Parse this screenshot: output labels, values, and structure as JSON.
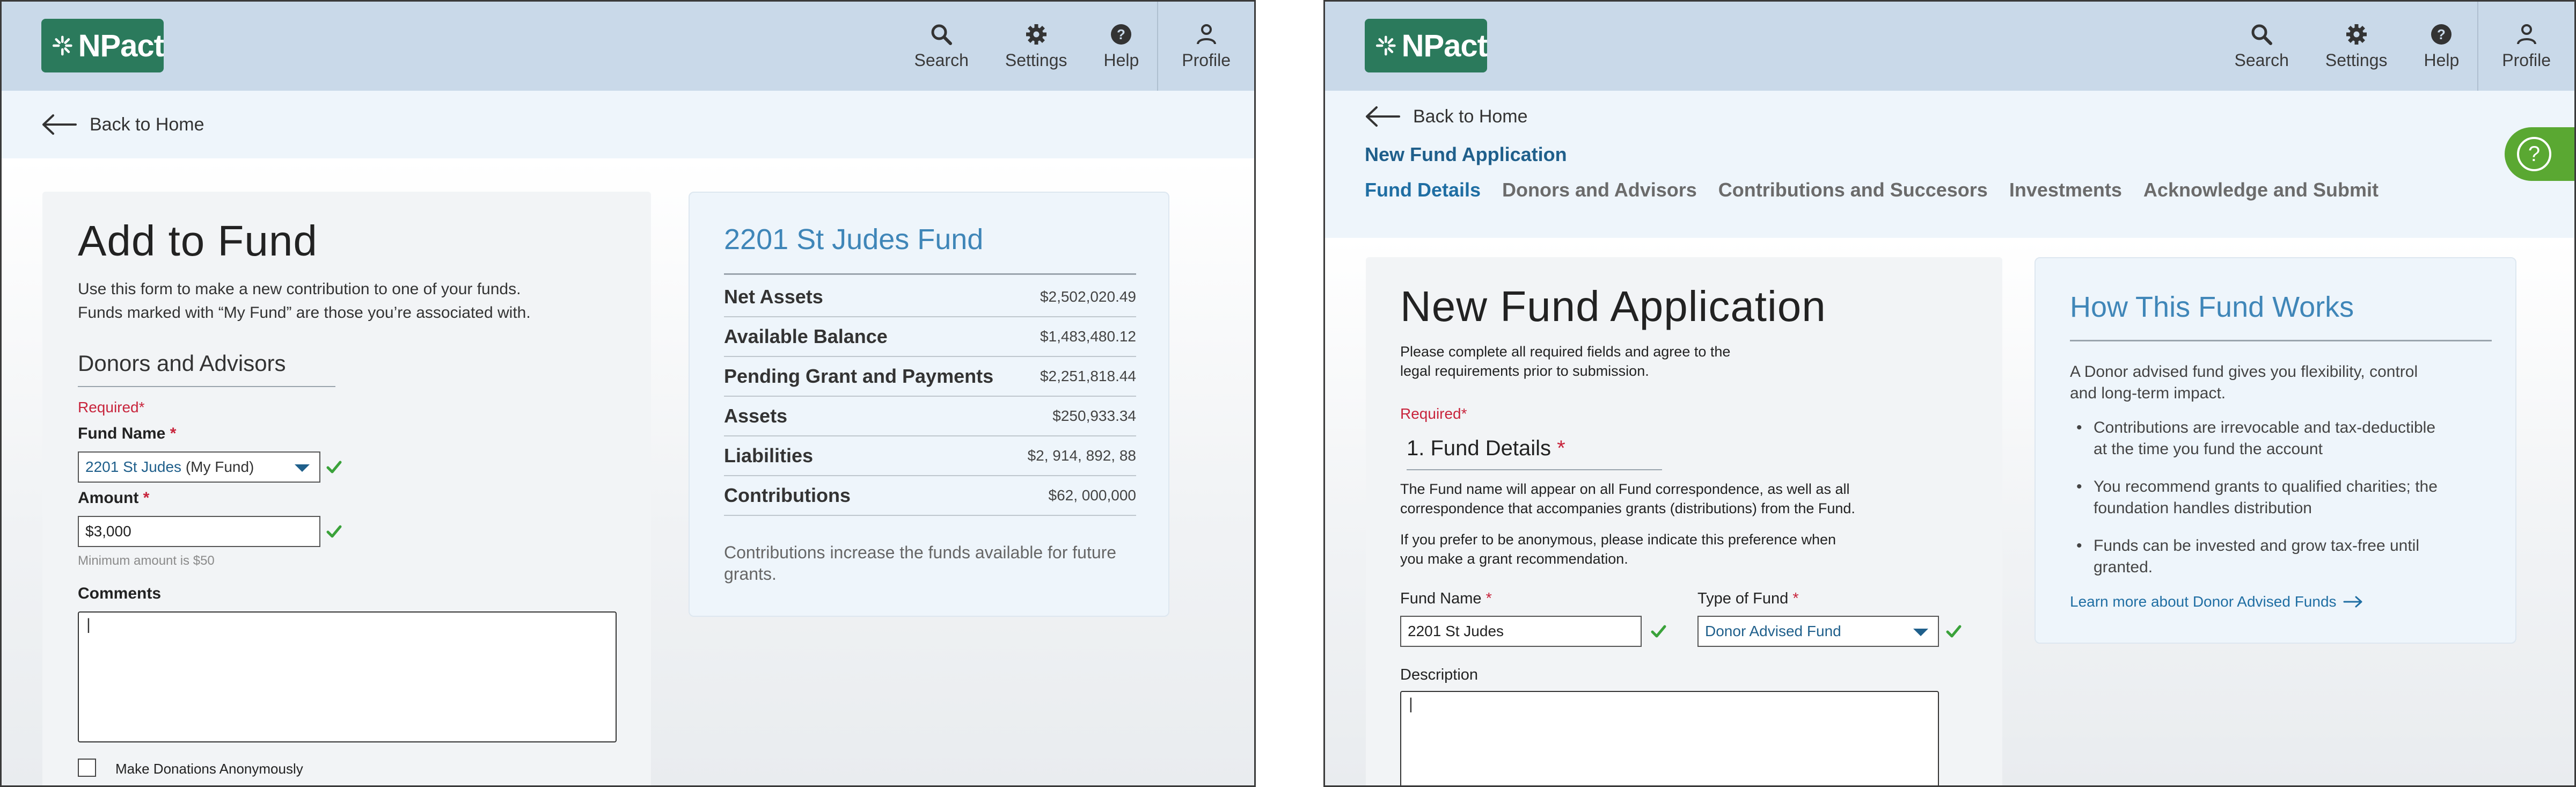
{
  "brand": {
    "logo_text": "NPact",
    "accent": "#2b7a5c"
  },
  "nav": {
    "search": "Search",
    "settings": "Settings",
    "help": "Help",
    "profile": "Profile"
  },
  "left": {
    "back_label": "Back to Home",
    "form": {
      "title": "Add to Fund",
      "intro_line1": "Use this form to make a new contribution to one of your funds.",
      "intro_line2": "Funds marked with “My Fund” are those you’re associated with.",
      "section_title": "Donors and Advisors",
      "required_label": "Required",
      "fund_name_label": "Fund Name",
      "fund_name_value": "2201 St Judes",
      "fund_name_suffix": "(My Fund)",
      "amount_label": "Amount",
      "amount_value": "$3,000",
      "amount_hint": "Minimum amount is $50",
      "comments_label": "Comments",
      "comments_value": "|",
      "anonymous_label": "Make Donations Anonymously"
    },
    "summary": {
      "title": "2201 St Judes Fund",
      "rows": [
        {
          "label": "Net Assets",
          "value": "$2,502,020.49"
        },
        {
          "label": "Available Balance",
          "value": "$1,483,480.12"
        },
        {
          "label": "Pending Grant and Payments",
          "value": "$2,251,818.44"
        },
        {
          "label": "Assets",
          "value": "$250,933.34"
        },
        {
          "label": "Liabilities",
          "value": "$2, 914, 892, 88"
        },
        {
          "label": "Contributions",
          "value": "$62, 000,000"
        }
      ],
      "note_line1": "Contributions increase the funds available for future",
      "note_line2": "grants."
    }
  },
  "right": {
    "back_label": "Back to Home",
    "breadcrumb_title": "New Fund Application",
    "tabs": [
      "Fund Details",
      "Donors and Advisors",
      "Contributions and Succesors",
      "Investments",
      "Acknowledge and Submit"
    ],
    "form": {
      "title": "New Fund Application",
      "intro_line1": "Please complete all required fields and agree to the",
      "intro_line2": "legal requirements prior to submission.",
      "required_label": "Required",
      "step_title": "1. Fund Details",
      "para1_line1": "The Fund name will appear on all Fund correspondence, as well as all",
      "para1_line2": "correspondence that accompanies grants (distributions) from the Fund.",
      "para2_line1": "If you prefer to be anonymous, please indicate this preference when",
      "para2_line2": "you make a grant recommendation.",
      "fund_name_label": "Fund Name",
      "fund_name_value": "2201 St Judes",
      "fund_type_label": "Type of Fund",
      "fund_type_value": "Donor Advised Fund",
      "description_label": "Description",
      "description_value": "|"
    },
    "how": {
      "title": "How This Fund Works",
      "intro_line1": "A Donor advised fund gives you flexibility, control",
      "intro_line2": "and long-term impact.",
      "bullets": [
        {
          "l1": "Contributions are irrevocable and tax-deductible",
          "l2": "at the time you fund the account"
        },
        {
          "l1": "You recommend grants to qualified charities; the",
          "l2": "foundation handles distribution"
        },
        {
          "l1": "Funds can be invested and grow tax-free until",
          "l2": "granted."
        }
      ],
      "learn_more": "Learn more about Donor Advised Funds"
    }
  },
  "colors": {
    "nav_bg": "#c9d9e9",
    "backbar_bg": "#eef5fb",
    "link_blue": "#1f6ea3",
    "heading_blue": "#3f86b8",
    "required_red": "#c8243c",
    "check_green": "#3aa23a",
    "help_green": "#5aa832"
  }
}
